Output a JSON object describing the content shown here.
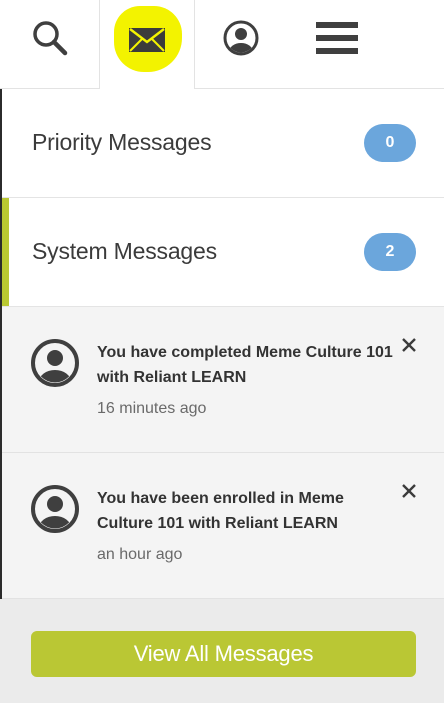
{
  "topbar": {
    "icons": [
      "search-icon",
      "mail-icon",
      "user-account-icon",
      "hamburger-menu-icon"
    ],
    "active_tab": "mail",
    "highlight_color": "#f3f300"
  },
  "categories": [
    {
      "label": "Priority Messages",
      "count": "0",
      "active": false
    },
    {
      "label": "System Messages",
      "count": "2",
      "active": true
    }
  ],
  "messages": [
    {
      "title": "You have completed Meme Culture 101 with Reliant LEARN",
      "time": "16 minutes ago",
      "icon": "user-avatar-icon"
    },
    {
      "title": "You have been enrolled in Meme Culture 101 with Reliant LEARN",
      "time": "an hour ago",
      "icon": "user-avatar-icon"
    }
  ],
  "footer": {
    "view_all_label": "View All Messages"
  },
  "colors": {
    "accent_green": "#b9c832",
    "badge_blue": "#6ba6dc",
    "icon_dark": "#3f3f3f"
  }
}
